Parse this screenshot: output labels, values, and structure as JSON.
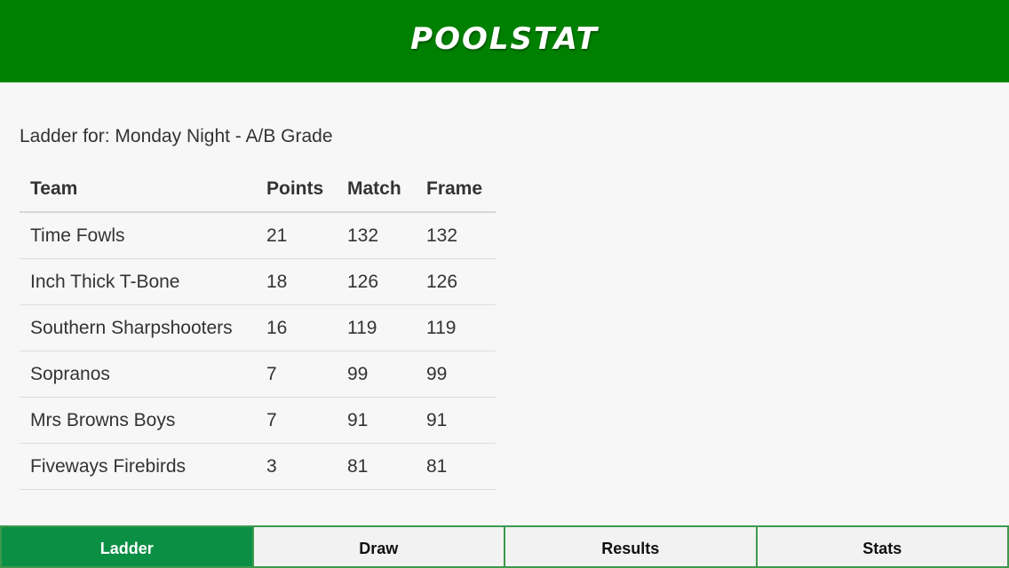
{
  "header": {
    "logo_text": "POOLSTAT",
    "background_color": "#008000"
  },
  "ladder": {
    "title": "Ladder for: Monday Night - A/B Grade",
    "columns": [
      "Team",
      "Points",
      "Match",
      "Frame"
    ],
    "rows": [
      {
        "team": "Time Fowls",
        "points": "21",
        "match": "132",
        "frame": "132"
      },
      {
        "team": "Inch Thick T-Bone",
        "points": "18",
        "match": "126",
        "frame": "126"
      },
      {
        "team": "Southern Sharpshooters",
        "points": "16",
        "match": "119",
        "frame": "119"
      },
      {
        "team": "Sopranos",
        "points": "7",
        "match": "99",
        "frame": "99"
      },
      {
        "team": "Mrs Browns Boys",
        "points": "7",
        "match": "91",
        "frame": "91"
      },
      {
        "team": "Fiveways Firebirds",
        "points": "3",
        "match": "81",
        "frame": "81"
      }
    ]
  },
  "tabs": [
    {
      "label": "Ladder",
      "active": true
    },
    {
      "label": "Draw",
      "active": false
    },
    {
      "label": "Results",
      "active": false
    },
    {
      "label": "Stats",
      "active": false
    }
  ],
  "colors": {
    "accent": "#0b8f45",
    "tab_border": "#3c9a4d"
  }
}
